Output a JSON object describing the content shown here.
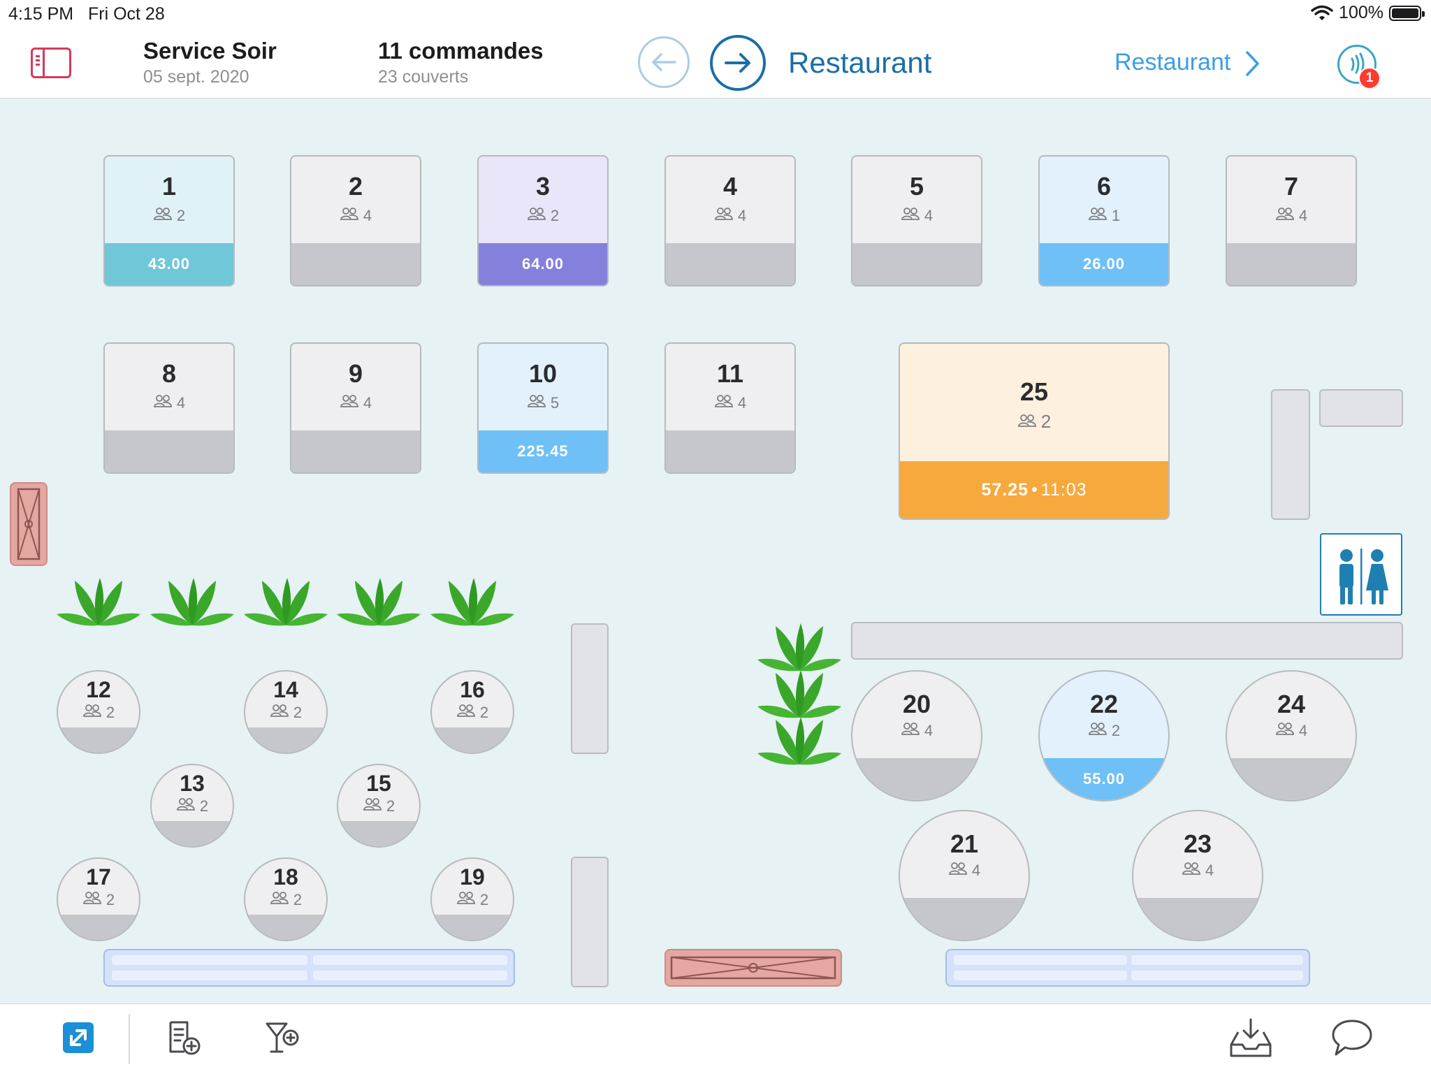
{
  "status_bar": {
    "time": "4:15 PM",
    "date": "Fri Oct 28",
    "battery": "100%"
  },
  "header": {
    "service_title": "Service Soir",
    "service_date": "05 sept. 2020",
    "orders": "11 commandes",
    "covers": "23 couverts",
    "room_title": "Restaurant",
    "room_link": "Restaurant",
    "notification_count": "1"
  },
  "tables": [
    {
      "num": "1",
      "covers": "2",
      "amount": "43.00",
      "status_color": "#6fc7d8",
      "body_color": "#e1f2f6"
    },
    {
      "num": "2",
      "covers": "4",
      "amount": "",
      "status_color": "#c6c7cc",
      "body_color": "#efeff1"
    },
    {
      "num": "3",
      "covers": "2",
      "amount": "64.00",
      "status_color": "#8580db",
      "body_color": "#e8e6f8"
    },
    {
      "num": "4",
      "covers": "4",
      "amount": "",
      "status_color": "#c6c7cc",
      "body_color": "#efeff1"
    },
    {
      "num": "5",
      "covers": "4",
      "amount": "",
      "status_color": "#c6c7cc",
      "body_color": "#efeff1"
    },
    {
      "num": "6",
      "covers": "1",
      "amount": "26.00",
      "status_color": "#6ec0f7",
      "body_color": "#e2f1fc"
    },
    {
      "num": "7",
      "covers": "4",
      "amount": "",
      "status_color": "#c6c7cc",
      "body_color": "#efeff1"
    },
    {
      "num": "8",
      "covers": "4",
      "amount": "",
      "status_color": "#c6c7cc",
      "body_color": "#efeff1"
    },
    {
      "num": "9",
      "covers": "4",
      "amount": "",
      "status_color": "#c6c7cc",
      "body_color": "#efeff1"
    },
    {
      "num": "10",
      "covers": "5",
      "amount": "225.45",
      "status_color": "#6ec0f7",
      "body_color": "#e2f1fc"
    },
    {
      "num": "11",
      "covers": "4",
      "amount": "",
      "status_color": "#c6c7cc",
      "body_color": "#efeff1"
    },
    {
      "num": "25",
      "covers": "2",
      "amount": "57.25",
      "time": "11:03",
      "status_color": "#f7a93d",
      "body_color": "#fdf0de"
    },
    {
      "num": "12",
      "covers": "2",
      "amount": "",
      "status_color": "#c6c7cc",
      "body_color": "#efeff1"
    },
    {
      "num": "14",
      "covers": "2",
      "amount": "",
      "status_color": "#c6c7cc",
      "body_color": "#efeff1"
    },
    {
      "num": "16",
      "covers": "2",
      "amount": "",
      "status_color": "#c6c7cc",
      "body_color": "#efeff1"
    },
    {
      "num": "13",
      "covers": "2",
      "amount": "",
      "status_color": "#c6c7cc",
      "body_color": "#efeff1"
    },
    {
      "num": "15",
      "covers": "2",
      "amount": "",
      "status_color": "#c6c7cc",
      "body_color": "#efeff1"
    },
    {
      "num": "17",
      "covers": "2",
      "amount": "",
      "status_color": "#c6c7cc",
      "body_color": "#efeff1"
    },
    {
      "num": "18",
      "covers": "2",
      "amount": "",
      "status_color": "#c6c7cc",
      "body_color": "#efeff1"
    },
    {
      "num": "19",
      "covers": "2",
      "amount": "",
      "status_color": "#c6c7cc",
      "body_color": "#efeff1"
    },
    {
      "num": "20",
      "covers": "4",
      "amount": "",
      "status_color": "#c6c7cc",
      "body_color": "#efeff1"
    },
    {
      "num": "22",
      "covers": "2",
      "amount": "55.00",
      "status_color": "#6ec0f7",
      "body_color": "#e2f1fc"
    },
    {
      "num": "24",
      "covers": "4",
      "amount": "",
      "status_color": "#c6c7cc",
      "body_color": "#efeff1"
    },
    {
      "num": "21",
      "covers": "4",
      "amount": "",
      "status_color": "#c6c7cc",
      "body_color": "#efeff1"
    },
    {
      "num": "23",
      "covers": "4",
      "amount": "",
      "status_color": "#c6c7cc",
      "body_color": "#efeff1"
    }
  ],
  "icons": {
    "sidebar": "sidebar-toggle-icon",
    "back": "arrow-left-circle-icon",
    "forward": "arrow-right-circle-icon",
    "chevron": "chevron-right-icon",
    "notifications": "nfc-notification-icon",
    "covers": "people-icon",
    "toolbar": [
      "move-table-icon",
      "new-order-icon",
      "new-drink-icon",
      "inbox-download-icon",
      "chat-bubble-icon"
    ]
  },
  "colors": {
    "accent": "#1c6ea6",
    "link": "#3b9ee5",
    "floor": "#e6f2f4",
    "alert": "#ff3b30",
    "plant": "#3aa72a"
  }
}
